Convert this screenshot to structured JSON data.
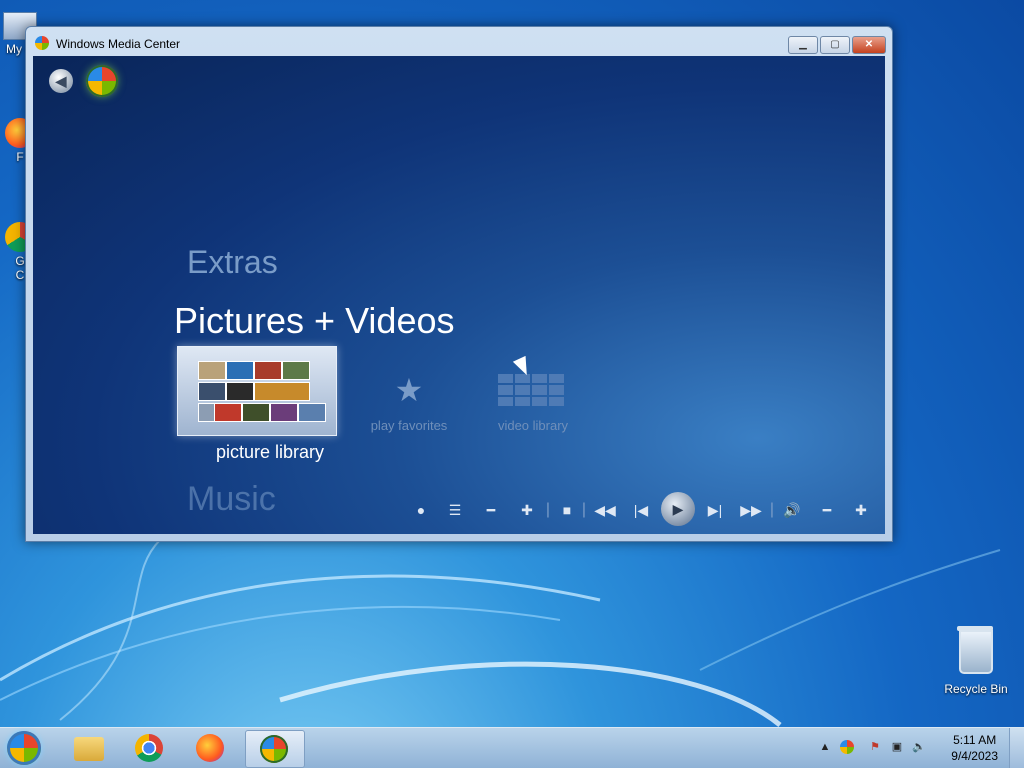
{
  "desktop": {
    "icons": [
      {
        "label": "My C"
      },
      {
        "label": "F"
      },
      {
        "label": "G\nC"
      }
    ],
    "recycle_bin": {
      "label": "Recycle Bin"
    }
  },
  "window": {
    "title": "Windows Media Center",
    "controls": {
      "minimize": "▁",
      "maximize": "▢",
      "close": "✕"
    }
  },
  "media_center": {
    "menu": {
      "extras": "Extras",
      "pictures_videos": "Pictures + Videos",
      "music": "Music"
    },
    "tiles": [
      {
        "label": "picture library",
        "selected": true
      },
      {
        "label": "play favorites",
        "selected": false
      },
      {
        "label": "video library",
        "selected": false
      }
    ],
    "transport_icons": [
      "record-icon",
      "guide-icon",
      "channel-down-icon",
      "channel-up-icon",
      "stop-icon",
      "rewind-icon",
      "previous-icon",
      "play-icon",
      "next-icon",
      "fast-forward-icon",
      "volume-icon",
      "volume-down-icon",
      "volume-up-icon"
    ]
  },
  "taskbar": {
    "pinned": [
      "windows-explorer-icon",
      "chrome-icon",
      "firefox-icon",
      "media-center-icon"
    ],
    "tray": {
      "chevron": "▲"
    },
    "clock": {
      "time": "5:11 AM",
      "date": "9/4/2023"
    }
  },
  "colors": {
    "content_bg": "#0f3478",
    "accent": "#1c4f95",
    "text_dim": "#7a9cc8"
  }
}
